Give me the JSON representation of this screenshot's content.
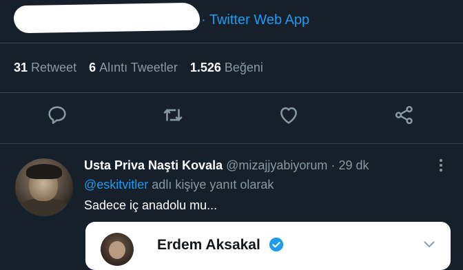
{
  "tweet": {
    "via_app": "· Twitter Web App",
    "stats": [
      {
        "count": "31",
        "label": "Retweet"
      },
      {
        "count": "6",
        "label": "Alıntı Tweetler"
      },
      {
        "count": "1.526",
        "label": "Beğeni"
      }
    ],
    "actions": [
      "reply-icon",
      "retweet-icon",
      "like-icon",
      "share-icon"
    ]
  },
  "reply": {
    "display_name": "Usta Priva Naşti Kovala",
    "handle": "@mizajjyabiyorum",
    "separator": "·",
    "time": "29 dk",
    "replying_mention": "@eskitvitler",
    "replying_suffix": " adlı kişiye yanıt olarak",
    "text": "Sadece iç anadolu mu...",
    "quoted": {
      "name": "Erdem Aksakal",
      "verified": true
    }
  },
  "colors": {
    "background": "#15202b",
    "accent": "#1d9bf0",
    "muted": "#8899a6",
    "divider": "#38444d"
  }
}
